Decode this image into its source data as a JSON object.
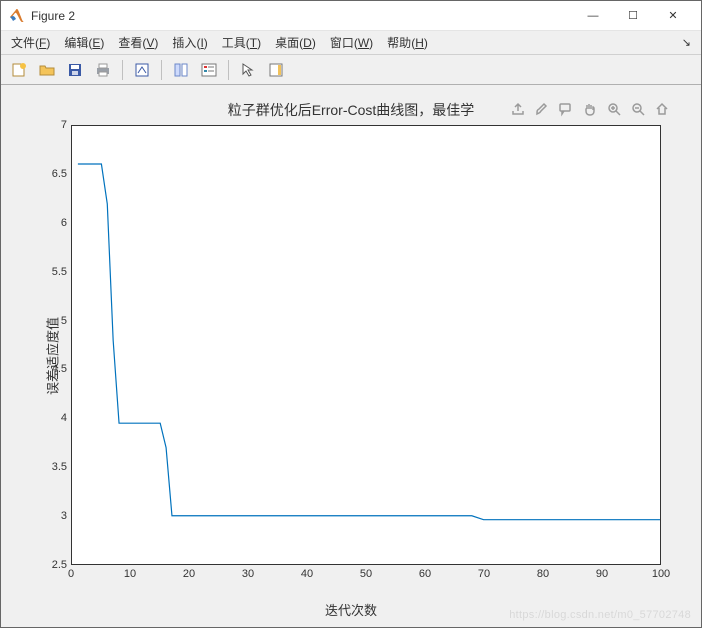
{
  "window": {
    "title": "Figure 2",
    "minimize": "—",
    "maximize": "☐",
    "close": "✕"
  },
  "menubar": {
    "file": {
      "label": "文件",
      "hotkey": "F"
    },
    "edit": {
      "label": "编辑",
      "hotkey": "E"
    },
    "view": {
      "label": "查看",
      "hotkey": "V"
    },
    "insert": {
      "label": "插入",
      "hotkey": "I"
    },
    "tools": {
      "label": "工具",
      "hotkey": "T"
    },
    "desktop": {
      "label": "桌面",
      "hotkey": "D"
    },
    "window": {
      "label": "窗口",
      "hotkey": "W"
    },
    "help": {
      "label": "帮助",
      "hotkey": "H"
    },
    "arrow": "↘"
  },
  "toolbar": {
    "new": "New Figure",
    "open": "Open",
    "save": "Save",
    "print": "Print",
    "link": "Link",
    "cursor": "Data Cursor",
    "legend": "Insert Legend",
    "arrow": "Edit Plot",
    "colorbar": "Insert Colorbar"
  },
  "axes_tools": {
    "export": "Export",
    "brush": "Brush",
    "tooltip": "Data Tips",
    "pan": "Pan",
    "zoomin": "Zoom In",
    "zoomout": "Zoom Out",
    "home": "Restore"
  },
  "chart_data": {
    "type": "line",
    "title": "粒子群优化后Error-Cost曲线图，最佳学",
    "xlabel": "迭代次数",
    "ylabel": "误差适应度值",
    "xlim": [
      0,
      100
    ],
    "ylim": [
      2.5,
      7
    ],
    "xticks": [
      0,
      10,
      20,
      30,
      40,
      50,
      60,
      70,
      80,
      90,
      100
    ],
    "yticks": [
      2.5,
      3,
      3.5,
      4,
      4.5,
      5,
      5.5,
      6,
      6.5,
      7
    ],
    "x": [
      1,
      2,
      3,
      4,
      5,
      6,
      7,
      8,
      9,
      10,
      11,
      12,
      13,
      14,
      15,
      16,
      17,
      18,
      19,
      20,
      25,
      30,
      35,
      40,
      45,
      50,
      55,
      60,
      65,
      68,
      70,
      75,
      80,
      85,
      90,
      95,
      100
    ],
    "y": [
      6.61,
      6.61,
      6.61,
      6.61,
      6.61,
      6.2,
      4.8,
      3.95,
      3.95,
      3.95,
      3.95,
      3.95,
      3.95,
      3.95,
      3.95,
      3.7,
      3.0,
      3.0,
      3.0,
      3.0,
      3.0,
      3.0,
      3.0,
      3.0,
      3.0,
      3.0,
      3.0,
      3.0,
      3.0,
      3.0,
      2.96,
      2.96,
      2.96,
      2.96,
      2.96,
      2.96,
      2.96
    ],
    "line_color": "#0072bd"
  },
  "watermark": "https://blog.csdn.net/m0_57702748"
}
